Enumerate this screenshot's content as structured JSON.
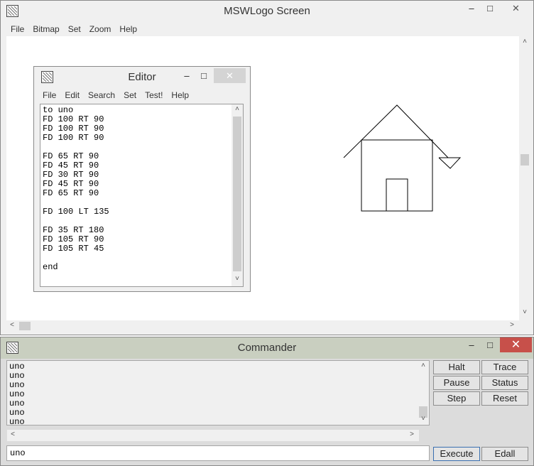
{
  "main": {
    "title": "MSWLogo Screen",
    "menu": [
      "File",
      "Bitmap",
      "Set",
      "Zoom",
      "Help"
    ],
    "controls": {
      "minimize": "–",
      "maximize": "□",
      "close": "✕"
    }
  },
  "editor": {
    "title": "Editor",
    "menu": [
      "File",
      "Edit",
      "Search",
      "Set",
      "Test!",
      "Help"
    ],
    "controls": {
      "minimize": "–",
      "maximize": "□",
      "close": "✕"
    },
    "code": "to uno\nFD 100 RT 90\nFD 100 RT 90\nFD 100 RT 90\n\nFD 65 RT 90\nFD 45 RT 90\nFD 30 RT 90\nFD 45 RT 90\nFD 65 RT 90\n\nFD 100 LT 135\n\nFD 35 RT 180\nFD 105 RT 90\nFD 105 RT 45\n\nend"
  },
  "commander": {
    "title": "Commander",
    "controls": {
      "minimize": "–",
      "maximize": "□",
      "close": "✕"
    },
    "history": "uno\nuno\nuno\nuno\nuno\nuno\nuno",
    "input_value": "uno",
    "buttons": {
      "halt": "Halt",
      "trace": "Trace",
      "pause": "Pause",
      "status": "Status",
      "step": "Step",
      "reset": "Reset",
      "execute": "Execute",
      "edall": "Edall"
    }
  },
  "icons": {
    "app": "logo-app-icon",
    "scroll_up": "˄",
    "scroll_down": "˅",
    "scroll_left": "˂",
    "scroll_right": "˃"
  },
  "colors": {
    "commander_titlebar": "#c9cfc0",
    "close_button": "#c7504a"
  }
}
